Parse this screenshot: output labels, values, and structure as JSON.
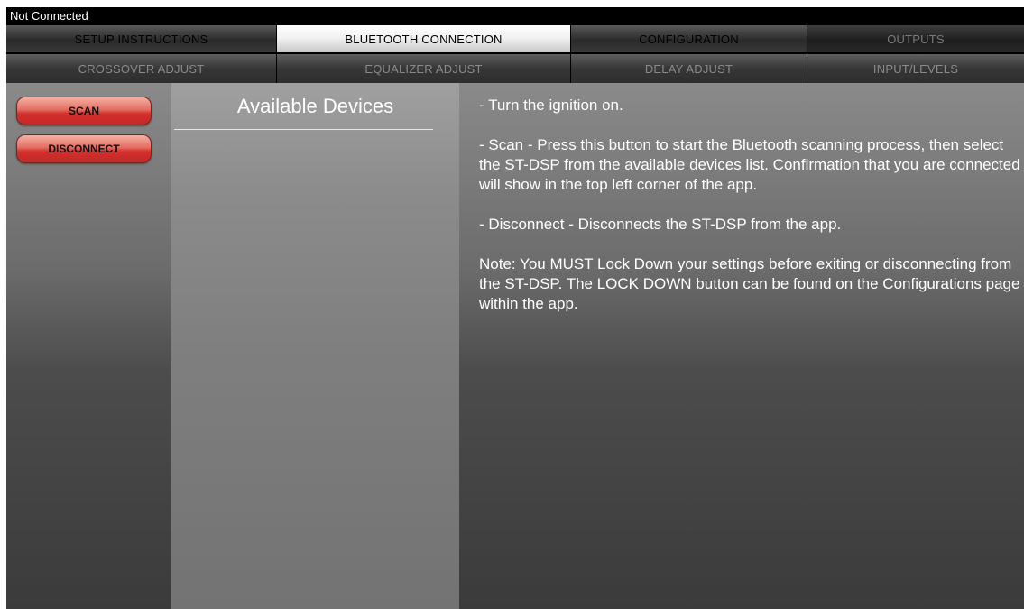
{
  "status": {
    "connection": "Not Connected"
  },
  "tabs_row1": [
    {
      "label": "SETUP INSTRUCTIONS",
      "state": "enabled"
    },
    {
      "label": "BLUETOOTH CONNECTION",
      "state": "selected"
    },
    {
      "label": "CONFIGURATION",
      "state": "enabled"
    },
    {
      "label": "OUTPUTS",
      "state": "disabled"
    }
  ],
  "tabs_row2": [
    {
      "label": "CROSSOVER ADJUST",
      "state": "disabled"
    },
    {
      "label": "EQUALIZER ADJUST",
      "state": "disabled"
    },
    {
      "label": "DELAY ADJUST",
      "state": "disabled"
    },
    {
      "label": "INPUT/LEVELS",
      "state": "disabled"
    }
  ],
  "actions": {
    "scan_label": "SCAN",
    "disconnect_label": "DISCONNECT"
  },
  "devices": {
    "title": "Available Devices",
    "items": []
  },
  "instructions": {
    "line1": "- Turn the ignition on.",
    "scan_text": " - Scan - Press this button to start the Bluetooth scanning process, then select the ST-DSP from the available devices list. Confirmation that you are connected will show in the top left corner of the app.",
    "disconnect_text": " - Disconnect - Disconnects the ST-DSP from the app.",
    "note_text": " Note: You MUST Lock Down your settings before exiting or disconnecting from the ST-DSP. The LOCK DOWN button can be found on the Configurations page within the app."
  },
  "colors": {
    "button_red": "#d3302b",
    "selected_tab": "#f2f2f2",
    "status_bar": "#000000"
  }
}
